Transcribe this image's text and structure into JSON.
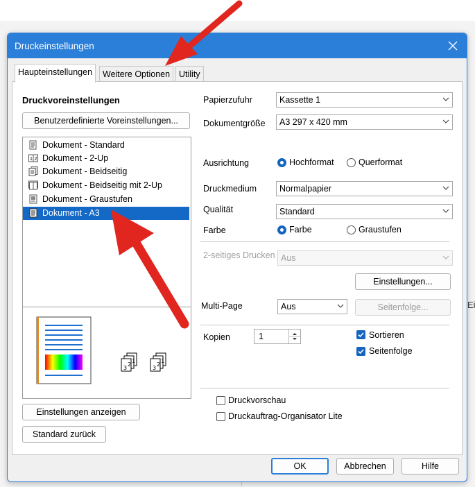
{
  "background": {
    "partial_text": "Ein"
  },
  "dialog": {
    "title": "Druckeinstellungen",
    "close_glyph": "✕",
    "tabs": [
      {
        "label": "Haupteinstellungen",
        "active": true
      },
      {
        "label": "Weitere Optionen",
        "active": false
      },
      {
        "label": "Utility",
        "active": false
      }
    ]
  },
  "presets": {
    "heading": "Druckvoreinstellungen",
    "custom_button": "Benutzerdefinierte Voreinstellungen...",
    "items": [
      {
        "label": "Dokument - Standard",
        "icon": "document-icon"
      },
      {
        "label": "Dokument - 2-Up",
        "icon": "two-up-icon"
      },
      {
        "label": "Dokument - Beidseitig",
        "icon": "duplex-icon"
      },
      {
        "label": "Dokument - Beidseitig mit 2-Up",
        "icon": "duplex-two-up-icon"
      },
      {
        "label": "Dokument - Graustufen",
        "icon": "grayscale-document-icon"
      },
      {
        "label": "Dokument - A3",
        "icon": "a3-document-icon",
        "selected": true
      }
    ],
    "show_settings_button": "Einstellungen anzeigen",
    "reset_button": "Standard zurück"
  },
  "settings": {
    "paper_source": {
      "label": "Papierzufuhr",
      "value": "Kassette 1"
    },
    "document_size": {
      "label": "Dokumentgröße",
      "value": "A3 297 x 420 mm"
    },
    "orientation": {
      "label": "Ausrichtung",
      "options": [
        "Hochformat",
        "Querformat"
      ],
      "selected": "Hochformat"
    },
    "media": {
      "label": "Druckmedium",
      "value": "Normalpapier"
    },
    "quality": {
      "label": "Qualität",
      "value": "Standard"
    },
    "color": {
      "label": "Farbe",
      "options": [
        "Farbe",
        "Graustufen"
      ],
      "selected": "Farbe"
    },
    "duplex": {
      "label": "2-seitiges Drucken",
      "value": "Aus",
      "enabled": false
    },
    "duplex_settings_button": "Einstellungen...",
    "multipage": {
      "label": "Multi-Page",
      "value": "Aus"
    },
    "page_order_button": "Seitenfolge...",
    "copies": {
      "label": "Kopien",
      "value": "1"
    },
    "collate": {
      "label": "Sortieren",
      "checked": true
    },
    "page_order": {
      "label": "Seitenfolge",
      "checked": true
    },
    "print_preview": {
      "label": "Druckvorschau",
      "checked": false
    },
    "job_organizer": {
      "label": "Druckauftrag-Organisator Lite",
      "checked": false
    }
  },
  "footer": {
    "ok": "OK",
    "cancel": "Abbrechen",
    "help": "Hilfe"
  },
  "colors": {
    "accent": "#2b7fd8",
    "selection": "#1468c6",
    "arrow": "#e0261f"
  }
}
